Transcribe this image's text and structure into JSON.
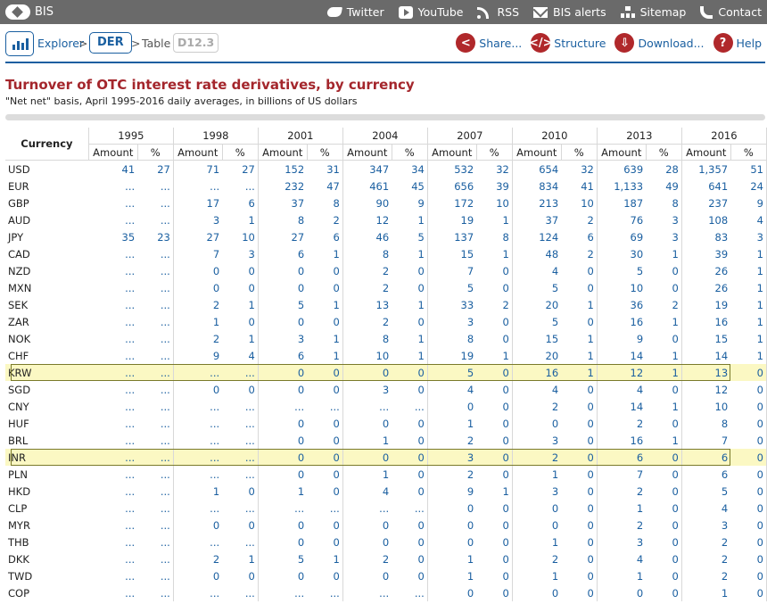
{
  "header": {
    "logo_text": "BIS",
    "links": [
      {
        "label": "Twitter",
        "icon": "twitter-icon"
      },
      {
        "label": "YouTube",
        "icon": "youtube-icon"
      },
      {
        "label": "RSS",
        "icon": "rss-icon"
      },
      {
        "label": "BIS alerts",
        "icon": "mail-icon"
      },
      {
        "label": "Sitemap",
        "icon": "sitemap-icon"
      },
      {
        "label": "Contact",
        "icon": "phone-icon"
      }
    ]
  },
  "breadcrumb": {
    "explorer": "Explorer",
    "sep1": ">",
    "der": "DER",
    "sep2": ">",
    "table": "Table",
    "table_id": "D12.3"
  },
  "actions": {
    "share": "Share...",
    "structure": "Structure",
    "download": "Download...",
    "help": "Help"
  },
  "page": {
    "title": "Turnover of OTC interest rate derivatives, by currency",
    "subtitle": "\"Net net\" basis, April 1995-2016 daily averages, in billions of US dollars"
  },
  "table": {
    "currency_header": "Currency",
    "years": [
      "1995",
      "1998",
      "2001",
      "2004",
      "2007",
      "2010",
      "2013",
      "2016"
    ],
    "amount_label": "Amount",
    "pct_label": "%",
    "highlighted": [
      "KRW",
      "INR"
    ],
    "rows": [
      {
        "cur": "USD",
        "v": [
          "41",
          "27",
          "71",
          "27",
          "152",
          "31",
          "347",
          "34",
          "532",
          "32",
          "654",
          "32",
          "639",
          "28",
          "1,357",
          "51"
        ]
      },
      {
        "cur": "EUR",
        "v": [
          "...",
          "...",
          "...",
          "...",
          "232",
          "47",
          "461",
          "45",
          "656",
          "39",
          "834",
          "41",
          "1,133",
          "49",
          "641",
          "24"
        ]
      },
      {
        "cur": "GBP",
        "v": [
          "...",
          "...",
          "17",
          "6",
          "37",
          "8",
          "90",
          "9",
          "172",
          "10",
          "213",
          "10",
          "187",
          "8",
          "237",
          "9"
        ]
      },
      {
        "cur": "AUD",
        "v": [
          "...",
          "...",
          "3",
          "1",
          "8",
          "2",
          "12",
          "1",
          "19",
          "1",
          "37",
          "2",
          "76",
          "3",
          "108",
          "4"
        ]
      },
      {
        "cur": "JPY",
        "v": [
          "35",
          "23",
          "27",
          "10",
          "27",
          "6",
          "46",
          "5",
          "137",
          "8",
          "124",
          "6",
          "69",
          "3",
          "83",
          "3"
        ]
      },
      {
        "cur": "CAD",
        "v": [
          "...",
          "...",
          "7",
          "3",
          "6",
          "1",
          "8",
          "1",
          "15",
          "1",
          "48",
          "2",
          "30",
          "1",
          "39",
          "1"
        ]
      },
      {
        "cur": "NZD",
        "v": [
          "...",
          "...",
          "0",
          "0",
          "0",
          "0",
          "2",
          "0",
          "7",
          "0",
          "4",
          "0",
          "5",
          "0",
          "26",
          "1"
        ]
      },
      {
        "cur": "MXN",
        "v": [
          "...",
          "...",
          "0",
          "0",
          "0",
          "0",
          "2",
          "0",
          "5",
          "0",
          "5",
          "0",
          "10",
          "0",
          "26",
          "1"
        ]
      },
      {
        "cur": "SEK",
        "v": [
          "...",
          "...",
          "2",
          "1",
          "5",
          "1",
          "13",
          "1",
          "33",
          "2",
          "20",
          "1",
          "36",
          "2",
          "19",
          "1"
        ]
      },
      {
        "cur": "ZAR",
        "v": [
          "...",
          "...",
          "1",
          "0",
          "0",
          "0",
          "2",
          "0",
          "3",
          "0",
          "5",
          "0",
          "16",
          "1",
          "16",
          "1"
        ]
      },
      {
        "cur": "NOK",
        "v": [
          "...",
          "...",
          "2",
          "1",
          "3",
          "1",
          "8",
          "1",
          "8",
          "0",
          "15",
          "1",
          "9",
          "0",
          "15",
          "1"
        ]
      },
      {
        "cur": "CHF",
        "v": [
          "...",
          "...",
          "9",
          "4",
          "6",
          "1",
          "10",
          "1",
          "19",
          "1",
          "20",
          "1",
          "14",
          "1",
          "14",
          "1"
        ]
      },
      {
        "cur": "KRW",
        "v": [
          "...",
          "...",
          "...",
          "...",
          "0",
          "0",
          "0",
          "0",
          "5",
          "0",
          "16",
          "1",
          "12",
          "1",
          "13",
          "0"
        ]
      },
      {
        "cur": "SGD",
        "v": [
          "...",
          "...",
          "0",
          "0",
          "0",
          "0",
          "3",
          "0",
          "4",
          "0",
          "4",
          "0",
          "4",
          "0",
          "12",
          "0"
        ]
      },
      {
        "cur": "CNY",
        "v": [
          "...",
          "...",
          "...",
          "...",
          "...",
          "...",
          "...",
          "...",
          "0",
          "0",
          "2",
          "0",
          "14",
          "1",
          "10",
          "0"
        ]
      },
      {
        "cur": "HUF",
        "v": [
          "...",
          "...",
          "...",
          "...",
          "0",
          "0",
          "0",
          "0",
          "1",
          "0",
          "0",
          "0",
          "2",
          "0",
          "8",
          "0"
        ]
      },
      {
        "cur": "BRL",
        "v": [
          "...",
          "...",
          "...",
          "...",
          "0",
          "0",
          "1",
          "0",
          "2",
          "0",
          "3",
          "0",
          "16",
          "1",
          "7",
          "0"
        ]
      },
      {
        "cur": "INR",
        "v": [
          "...",
          "...",
          "...",
          "...",
          "0",
          "0",
          "0",
          "0",
          "3",
          "0",
          "2",
          "0",
          "6",
          "0",
          "6",
          "0"
        ]
      },
      {
        "cur": "PLN",
        "v": [
          "...",
          "...",
          "...",
          "...",
          "0",
          "0",
          "1",
          "0",
          "2",
          "0",
          "1",
          "0",
          "7",
          "0",
          "6",
          "0"
        ]
      },
      {
        "cur": "HKD",
        "v": [
          "...",
          "...",
          "1",
          "0",
          "1",
          "0",
          "4",
          "0",
          "9",
          "1",
          "3",
          "0",
          "2",
          "0",
          "5",
          "0"
        ]
      },
      {
        "cur": "CLP",
        "v": [
          "...",
          "...",
          "...",
          "...",
          "...",
          "...",
          "...",
          "...",
          "0",
          "0",
          "0",
          "0",
          "1",
          "0",
          "4",
          "0"
        ]
      },
      {
        "cur": "MYR",
        "v": [
          "...",
          "...",
          "0",
          "0",
          "0",
          "0",
          "0",
          "0",
          "0",
          "0",
          "0",
          "0",
          "2",
          "0",
          "3",
          "0"
        ]
      },
      {
        "cur": "THB",
        "v": [
          "...",
          "...",
          "...",
          "...",
          "0",
          "0",
          "0",
          "0",
          "0",
          "0",
          "1",
          "0",
          "3",
          "0",
          "2",
          "0"
        ]
      },
      {
        "cur": "DKK",
        "v": [
          "...",
          "...",
          "2",
          "1",
          "5",
          "1",
          "2",
          "0",
          "1",
          "0",
          "2",
          "0",
          "4",
          "0",
          "2",
          "0"
        ]
      },
      {
        "cur": "TWD",
        "v": [
          "...",
          "...",
          "0",
          "0",
          "0",
          "0",
          "0",
          "0",
          "1",
          "0",
          "1",
          "0",
          "1",
          "0",
          "2",
          "0"
        ]
      },
      {
        "cur": "COP",
        "v": [
          "...",
          "...",
          "...",
          "...",
          "...",
          "...",
          "...",
          "...",
          "0",
          "0",
          "0",
          "0",
          "0",
          "0",
          "1",
          "0"
        ]
      }
    ]
  }
}
